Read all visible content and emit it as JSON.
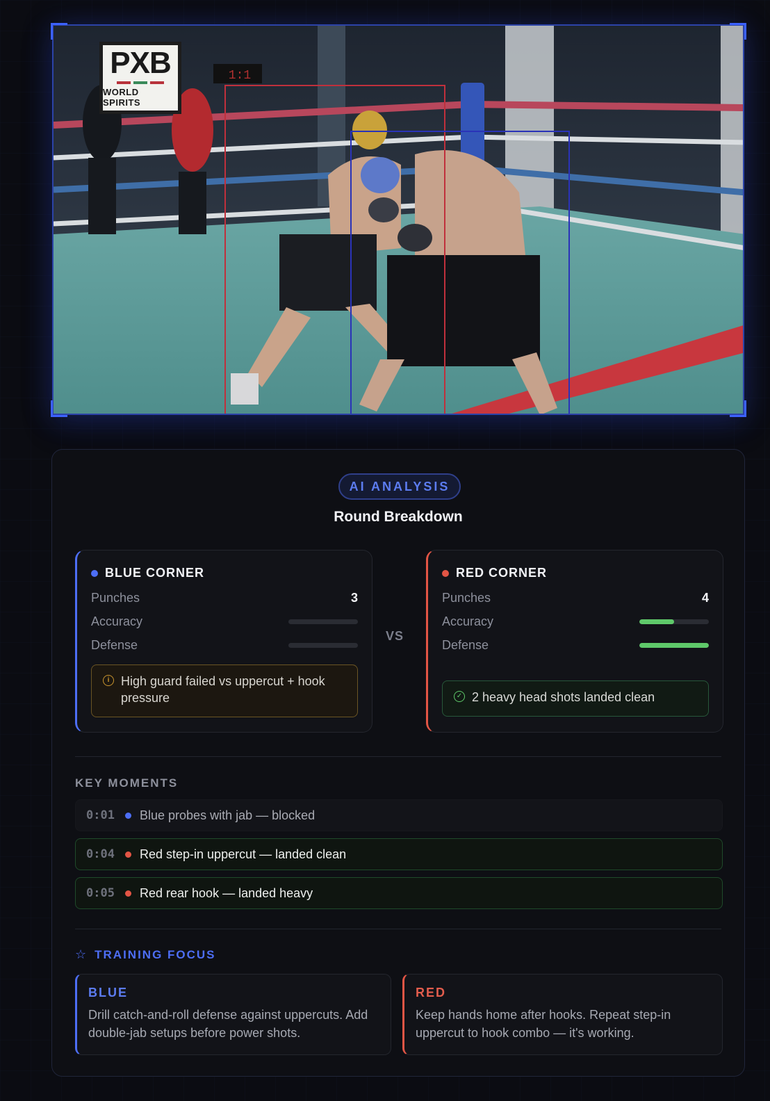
{
  "video": {
    "logo_text": "PXB",
    "logo_sub": "WORLD SPIRITS"
  },
  "analysis": {
    "badge": "AI ANALYSIS",
    "title": "Round Breakdown",
    "vs": "VS",
    "blue": {
      "name": "BLUE CORNER",
      "color": "#4d6ef5",
      "punches_label": "Punches",
      "punches": "3",
      "accuracy_label": "Accuracy",
      "accuracy": 0,
      "defense_label": "Defense",
      "defense": 0,
      "note": "High guard failed vs uppercut + hook pressure",
      "note_icon": "info-icon"
    },
    "red": {
      "name": "RED CORNER",
      "color": "#e25545",
      "punches_label": "Punches",
      "punches": "4",
      "accuracy_label": "Accuracy",
      "accuracy": 0.5,
      "defense_label": "Defense",
      "defense": 1.0,
      "note": "2 heavy head shots landed clean",
      "note_icon": "check-circle-icon"
    }
  },
  "key_moments": {
    "label": "KEY MOMENTS",
    "items": [
      {
        "time": "0:01",
        "corner": "blue",
        "text": "Blue probes with jab — blocked"
      },
      {
        "time": "0:04",
        "corner": "red",
        "text": "Red step-in uppercut — landed clean"
      },
      {
        "time": "0:05",
        "corner": "red",
        "text": "Red rear hook — landed heavy"
      }
    ]
  },
  "training": {
    "label": "TRAINING FOCUS",
    "icon": "star-icon",
    "blue": {
      "title": "BLUE",
      "text": "Drill catch-and-roll defense against uppercuts. Add double-jab setups before power shots."
    },
    "red": {
      "title": "RED",
      "text": "Keep hands home after hooks. Repeat step-in uppercut to hook combo — it's working."
    }
  }
}
